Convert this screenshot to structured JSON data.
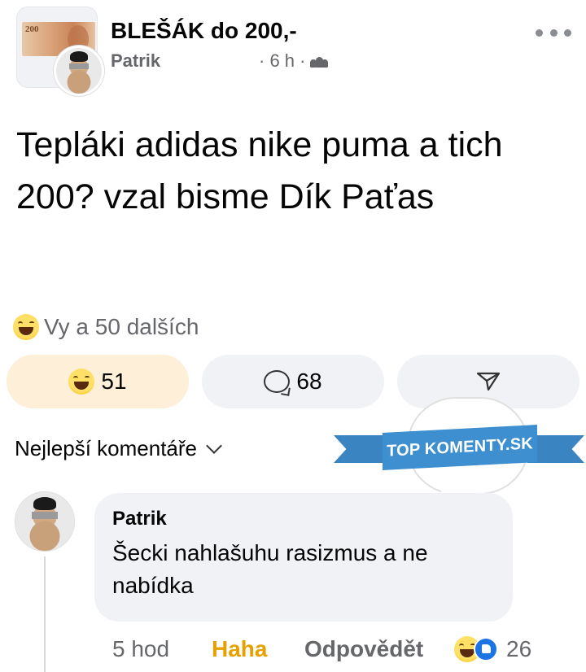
{
  "header": {
    "group_name": "BLEŠÁK do 200,-",
    "author": "Patrik",
    "time": "· 6 h ·",
    "banknote_value": "200"
  },
  "post": {
    "text": "Tepláki adidas nike puma a tich 200? vzal bisme Dík Paťas"
  },
  "reactions": {
    "summary": "Vy a 50 dalších",
    "haha_count": "51",
    "comment_count": "68"
  },
  "comments_section": {
    "filter_label": "Nejlepší komentáře"
  },
  "watermark": {
    "text": "TOP KOMENTY.SK"
  },
  "comment": {
    "author": "Patrik",
    "text": "Šecki nahlašuhu rasizmus a ne nabídka",
    "time": "5 hod",
    "reaction_label": "Haha",
    "reply_label": "Odpovědět",
    "reaction_count": "26"
  },
  "colors": {
    "haha_accent": "#e6a100",
    "react_pill_bg": "#fdefd8",
    "pill_bg": "#f0f2f5",
    "watermark_blue": "#3d8fcf"
  }
}
